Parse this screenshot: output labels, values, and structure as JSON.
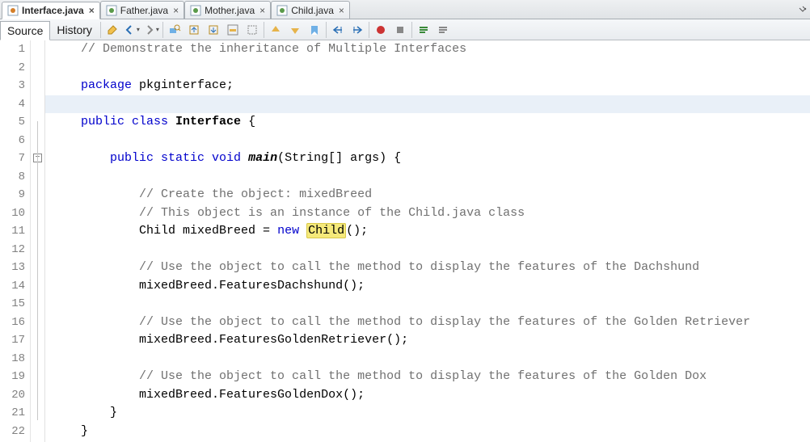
{
  "tabs": [
    {
      "label": "Interface.java",
      "active": true
    },
    {
      "label": "Father.java",
      "active": false
    },
    {
      "label": "Mother.java",
      "active": false
    },
    {
      "label": "Child.java",
      "active": false
    }
  ],
  "subbar": {
    "source": "Source",
    "history": "History"
  },
  "gutter_start": 1,
  "gutter_end": 22,
  "highlight_line": 4,
  "code": {
    "l1": {
      "indent": "    ",
      "comment": "// Demonstrate the inheritance of Multiple Interfaces"
    },
    "l2": "",
    "l3": {
      "indent": "    ",
      "kw1": "package",
      "rest": " pkginterface;"
    },
    "l4": "",
    "l5": {
      "indent": "    ",
      "kw1": "public",
      "kw2": " class ",
      "cls": "Interface",
      "rest": " {"
    },
    "l6": "",
    "l7": {
      "indent": "        ",
      "kw1": "public",
      "kw2": " static",
      "kw3": " void ",
      "mth": "main",
      "rest1": "(String[] args) {"
    },
    "l8": "",
    "l9": {
      "indent": "            ",
      "comment": "// Create the object: mixedBreed"
    },
    "l10": {
      "indent": "            ",
      "comment": "// This object is an instance of the Child.java class"
    },
    "l11": {
      "indent": "            ",
      "txt1": "Child mixedBreed = ",
      "kw": "new",
      "txt2": " ",
      "mark": "Child",
      "txt3": "();"
    },
    "l12": "",
    "l13": {
      "indent": "            ",
      "comment": "// Use the object to call the method to display the features of the Dachshund"
    },
    "l14": {
      "indent": "            ",
      "txt": "mixedBreed.FeaturesDachshund();"
    },
    "l15": "",
    "l16": {
      "indent": "            ",
      "comment": "// Use the object to call the method to display the features of the Golden Retriever"
    },
    "l17": {
      "indent": "            ",
      "txt": "mixedBreed.FeaturesGoldenRetriever();"
    },
    "l18": "",
    "l19": {
      "indent": "            ",
      "comment": "// Use the object to call the method to display the features of the Golden Dox"
    },
    "l20": {
      "indent": "            ",
      "txt": "mixedBreed.FeaturesGoldenDox();"
    },
    "l21": {
      "indent": "        ",
      "txt": "}"
    },
    "l22": {
      "indent": "    ",
      "txt": "}"
    }
  }
}
